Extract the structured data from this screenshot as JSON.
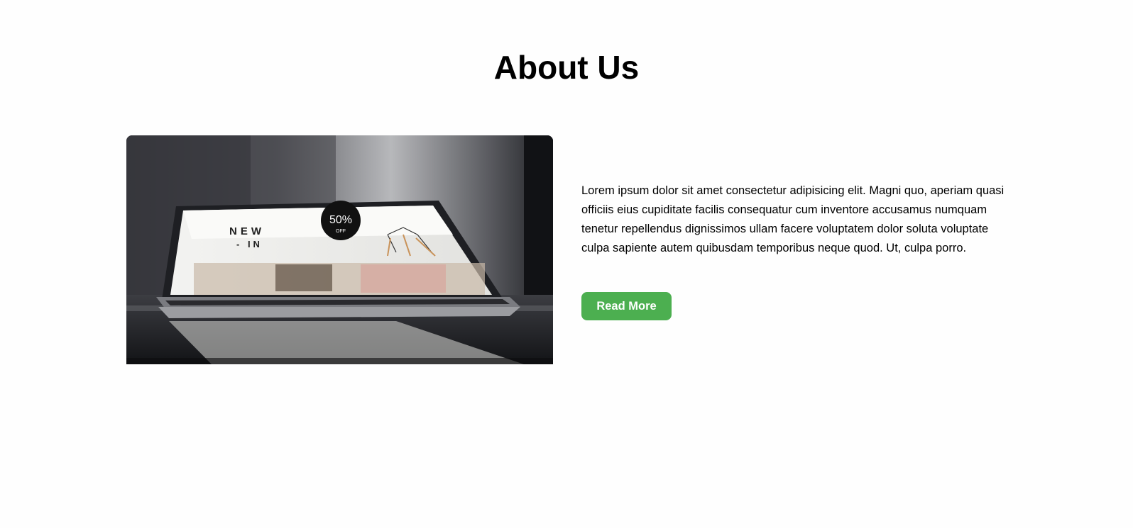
{
  "section": {
    "title": "About Us",
    "paragraph": "Lorem ipsum dolor sit amet consectetur adipisicing elit. Magni quo, aperiam quasi officiis eius cupiditate facilis consequatur cum inventore accusamus numquam tenetur repellendus dignissimos ullam facere voluptatem dolor soluta voluptate culpa sapiente autem quibusdam temporibus neque quod. Ut, culpa porro.",
    "button_label": "Read More"
  },
  "image": {
    "screen_headline_1": "NEW",
    "screen_headline_2": "- IN",
    "screen_badge": "50%",
    "screen_badge_sub": "OFF"
  },
  "colors": {
    "button_bg": "#4caf50",
    "button_text": "#ffffff",
    "page_bg": "#fefefe"
  }
}
